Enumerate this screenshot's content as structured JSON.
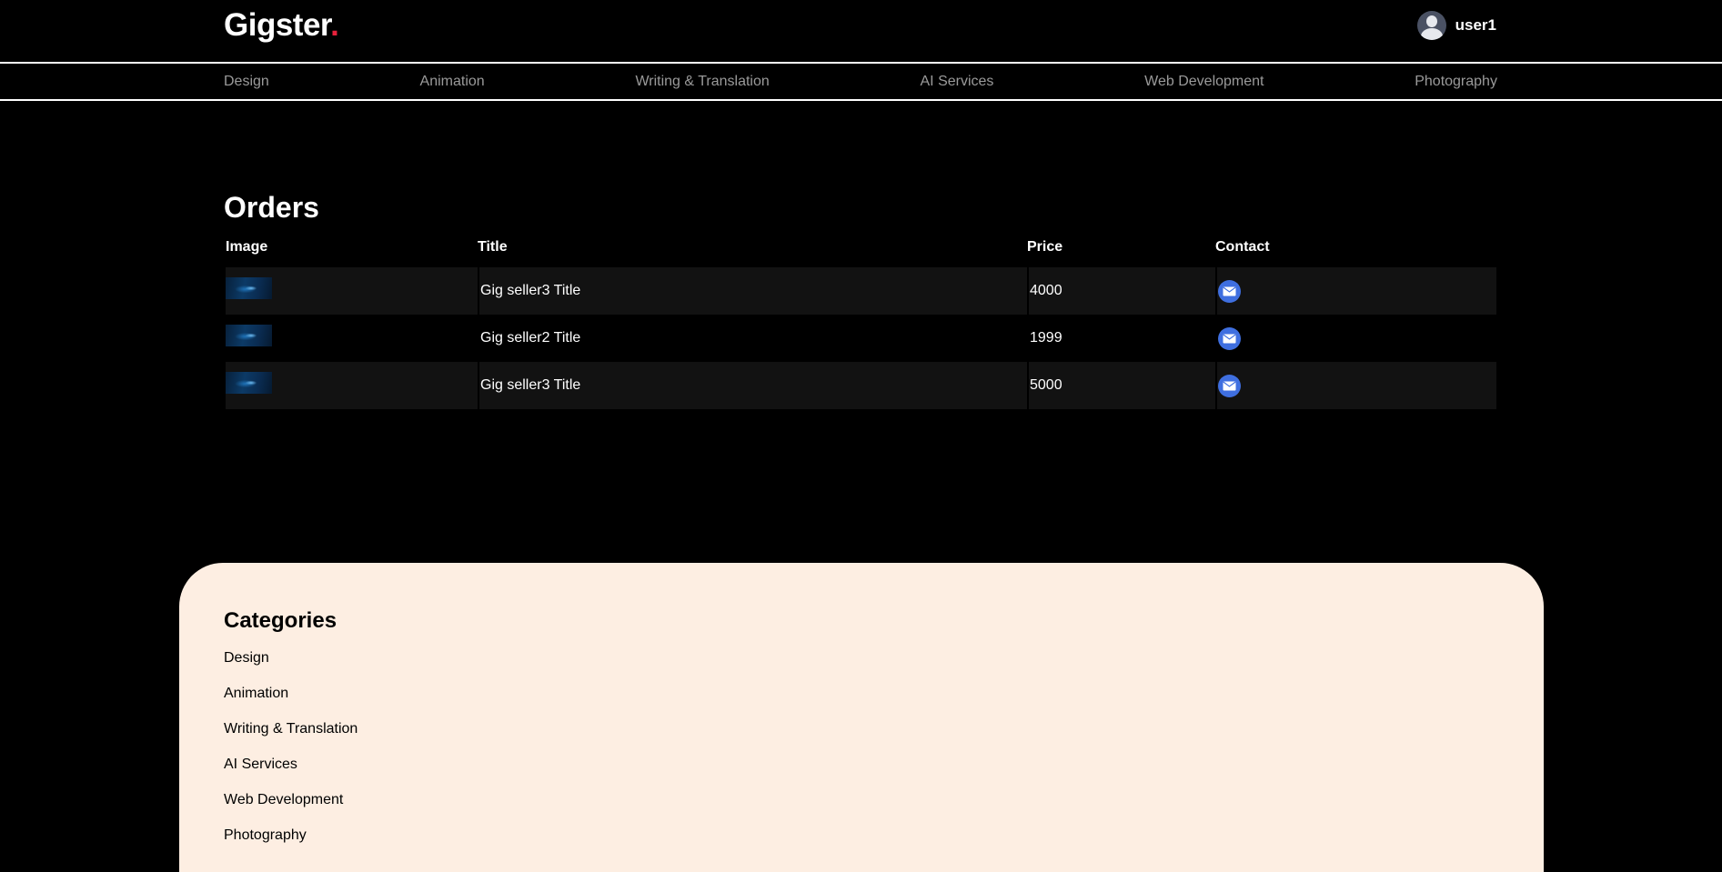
{
  "header": {
    "logo_text": "Gigster",
    "logo_dot": ".",
    "logo_dot_color": "#e8213b",
    "username": "user1",
    "avatar_icon": "user-avatar-icon"
  },
  "nav": {
    "items": [
      {
        "label": "Design"
      },
      {
        "label": "Animation"
      },
      {
        "label": "Writing & Translation"
      },
      {
        "label": "AI Services"
      },
      {
        "label": "Web Development"
      },
      {
        "label": "Photography"
      }
    ]
  },
  "orders": {
    "title": "Orders",
    "columns": [
      "Image",
      "Title",
      "Price",
      "Contact"
    ],
    "rows": [
      {
        "title": "Gig seller3 Title",
        "price": "4000",
        "contact_icon": "mail-icon"
      },
      {
        "title": "Gig seller2 Title",
        "price": "1999",
        "contact_icon": "mail-icon"
      },
      {
        "title": "Gig seller3 Title",
        "price": "5000",
        "contact_icon": "mail-icon"
      }
    ]
  },
  "footer": {
    "title": "Categories",
    "items": [
      {
        "label": "Design"
      },
      {
        "label": "Animation"
      },
      {
        "label": "Writing & Translation"
      },
      {
        "label": "AI Services"
      },
      {
        "label": "Web Development"
      },
      {
        "label": "Photography"
      }
    ]
  },
  "colors": {
    "background": "#000000",
    "footer_background": "#fdeee2",
    "row_stripe": "#121212",
    "nav_text": "#9a9a9a",
    "mail_button": "#3f6fe0"
  }
}
